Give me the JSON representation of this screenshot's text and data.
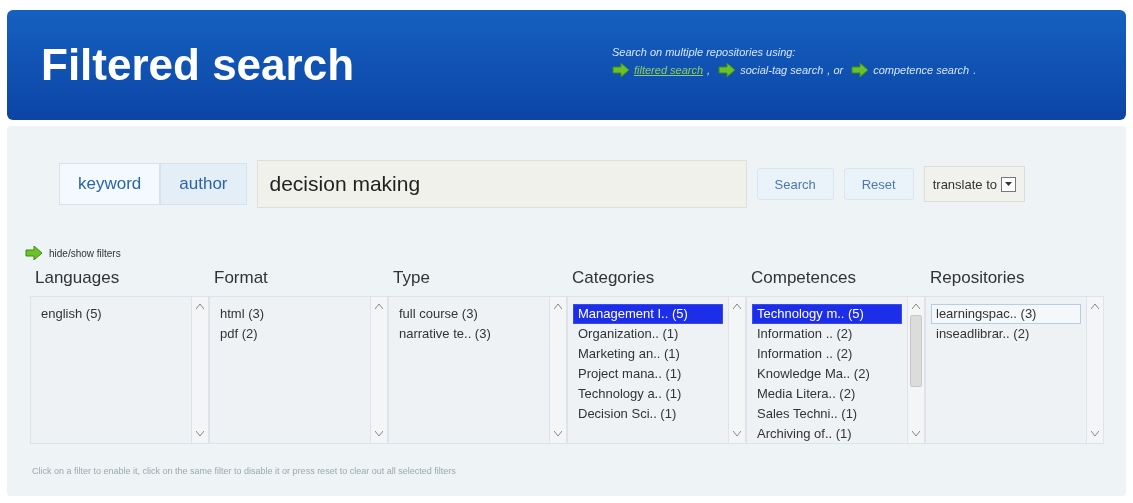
{
  "header": {
    "title": "Filtered search",
    "intro": "Search on multiple repositories using:",
    "links": [
      {
        "label": "filtered search",
        "current": true,
        "after": ","
      },
      {
        "label": "social-tag search",
        "current": false,
        "after": ", or"
      },
      {
        "label": "competence search",
        "current": false,
        "after": "."
      }
    ]
  },
  "search": {
    "tabs": [
      {
        "label": "keyword",
        "selected": true
      },
      {
        "label": "author",
        "selected": false
      }
    ],
    "query": "decision making",
    "buttons": [
      "Search",
      "Reset"
    ],
    "translate": "translate to"
  },
  "filters_toggle": "hide/show filters",
  "filters": [
    {
      "title": "Languages",
      "scrolled": false,
      "items": [
        {
          "label": "english (5)",
          "selected": false,
          "focused": false
        }
      ]
    },
    {
      "title": "Format",
      "scrolled": false,
      "items": [
        {
          "label": "html (3)",
          "selected": false,
          "focused": false
        },
        {
          "label": "pdf (2)",
          "selected": false,
          "focused": false
        }
      ]
    },
    {
      "title": "Type",
      "scrolled": false,
      "items": [
        {
          "label": "full course (3)",
          "selected": false,
          "focused": false
        },
        {
          "label": "narrative te.. (3)",
          "selected": false,
          "focused": false
        }
      ]
    },
    {
      "title": "Categories",
      "scrolled": false,
      "items": [
        {
          "label": "Management I.. (5)",
          "selected": true,
          "focused": false
        },
        {
          "label": "Organization.. (1)",
          "selected": false,
          "focused": false
        },
        {
          "label": "Marketing an.. (1)",
          "selected": false,
          "focused": false
        },
        {
          "label": "Project mana.. (1)",
          "selected": false,
          "focused": false
        },
        {
          "label": "Technology a.. (1)",
          "selected": false,
          "focused": false
        },
        {
          "label": "Decision Sci.. (1)",
          "selected": false,
          "focused": false
        }
      ]
    },
    {
      "title": "Competences",
      "scrolled": true,
      "items": [
        {
          "label": "Technology m.. (5)",
          "selected": true,
          "focused": false
        },
        {
          "label": "Information .. (2)",
          "selected": false,
          "focused": false
        },
        {
          "label": "Information .. (2)",
          "selected": false,
          "focused": false
        },
        {
          "label": "Knowledge Ma.. (2)",
          "selected": false,
          "focused": false
        },
        {
          "label": "Media Litera.. (2)",
          "selected": false,
          "focused": false
        },
        {
          "label": "Sales Techni.. (1)",
          "selected": false,
          "focused": false
        },
        {
          "label": "Archiving of.. (1)",
          "selected": false,
          "focused": false
        }
      ]
    },
    {
      "title": "Repositories",
      "scrolled": false,
      "items": [
        {
          "label": "learningspac.. (3)",
          "selected": false,
          "focused": true
        },
        {
          "label": "inseadlibrar.. (2)",
          "selected": false,
          "focused": false
        }
      ]
    }
  ],
  "hint": "Click on a filter to enable it, click on the same filter to disable it or press reset to clear out all selected filters"
}
